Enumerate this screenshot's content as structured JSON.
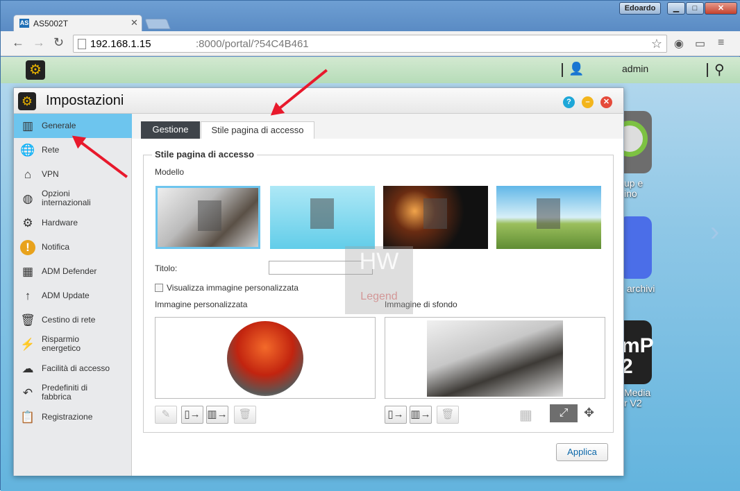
{
  "browser": {
    "user_badge": "Edoardo",
    "tab_title": "AS5002T",
    "favicon": "AS",
    "url_host": "192.168.1.15",
    "url_rest": ":8000/portal/?54C4B461"
  },
  "adm": {
    "user": "admin"
  },
  "desktop": {
    "icon1_label": "up e\nino",
    "icon2_label": " archivi",
    "icon3_glyph": "mP\n2",
    "icon3_label": "Media\nr V2"
  },
  "dialog": {
    "title": "Impostazioni"
  },
  "sidebar": {
    "items": [
      {
        "label": "Generale",
        "icon": "server-icon"
      },
      {
        "label": "Rete",
        "icon": "globe-icon"
      },
      {
        "label": "VPN",
        "icon": "network-icon"
      },
      {
        "label": "Opzioni\ninternazionali",
        "icon": "world-pin-icon"
      },
      {
        "label": "Hardware",
        "icon": "hardware-icon"
      },
      {
        "label": "Notifica",
        "icon": "alert-icon"
      },
      {
        "label": "ADM Defender",
        "icon": "firewall-icon"
      },
      {
        "label": "ADM Update",
        "icon": "update-arrow-icon"
      },
      {
        "label": "Cestino di rete",
        "icon": "trash-icon"
      },
      {
        "label": "Risparmio\nenergetico",
        "icon": "lightning-icon"
      },
      {
        "label": "Facilità di accesso",
        "icon": "cloud-up-icon"
      },
      {
        "label": "Predefiniti di\nfabbrica",
        "icon": "undo-icon"
      },
      {
        "label": "Registrazione",
        "icon": "clipboard-icon"
      }
    ]
  },
  "tabs": {
    "gestione": "Gestione",
    "stile": "Stile pagina di accesso"
  },
  "form": {
    "legend": "Stile pagina di accesso",
    "modello": "Modello",
    "titolo": "Titolo:",
    "titolo_value": "",
    "checkbox": "Visualizza immagine personalizzata",
    "img_pers": "Immagine personalizzata",
    "img_sfondo": "Immagine di sfondo",
    "apply": "Applica"
  },
  "watermark": {
    "big": "HW",
    "small": "Legend"
  },
  "colors": {
    "accent": "#6dc5ee",
    "annotation": "#e8192c",
    "tab_dark": "#3f444a"
  }
}
